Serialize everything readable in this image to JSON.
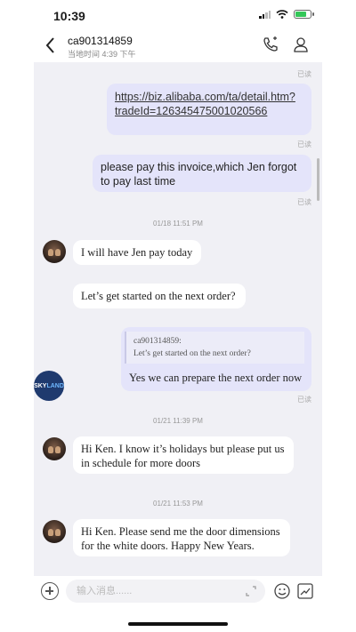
{
  "status": {
    "time": "10:39"
  },
  "header": {
    "title": "ca901314859",
    "subtitle": "当地时间 4:39 下午"
  },
  "messages": {
    "read_label": "已读",
    "link_line1": "https://biz.alibaba.com/ta/detail.htm?",
    "link_line2": "tradeId=126345475001020566",
    "invoice_line1": "please pay this invoice,which Jen forgot",
    "invoice_line2": "to pay last time",
    "stamp1": "01/18 11:51 PM",
    "in1": "I will have Jen pay today",
    "in2": "Let’s get started on the next order?",
    "quote_sender": "ca901314859:",
    "quote_text": "Let’s get started on the next order?",
    "reply": "Yes we can prepare the next order now",
    "stamp2": "01/21 11:39 PM",
    "in3_line1": "Hi Ken. I know it’s holidays but please put us",
    "in3_line2": "in schedule for more doors",
    "stamp3": "01/21 11:53 PM",
    "in4_line1": "Hi Ken. Please send me the door dimensions",
    "in4_line2": "for the white doors. Happy New Years."
  },
  "sky_avatar": {
    "text_a": "SKY",
    "text_b": "LAND"
  },
  "input": {
    "placeholder": "输入消息......"
  },
  "colors": {
    "outgoing_bubble": "#e4e4fa",
    "chat_background": "#f0f0f5",
    "battery": "#34c759"
  }
}
